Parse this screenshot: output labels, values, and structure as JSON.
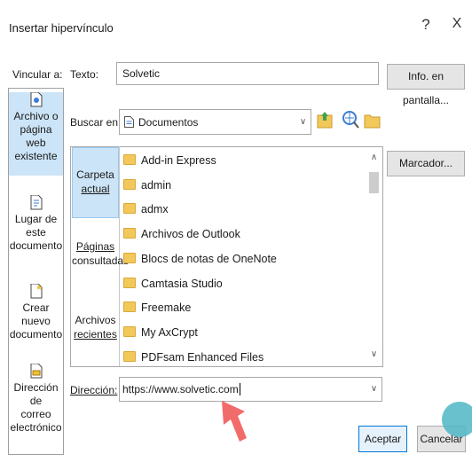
{
  "dialog": {
    "title": "Insertar hipervínculo",
    "help_label": "?",
    "close_label": "X"
  },
  "link_to": {
    "label": "Vincular a:",
    "items": [
      {
        "label": "Archivo o página web existente",
        "lines": [
          "Archivo o",
          "página web",
          "existente"
        ],
        "selected": true,
        "icon": "web-file-icon"
      },
      {
        "label": "Lugar de este documento",
        "lines": [
          "Lugar de este",
          "documento"
        ],
        "selected": false,
        "icon": "document-place-icon"
      },
      {
        "label": "Crear nuevo documento",
        "lines": [
          "Crear nuevo",
          "documento"
        ],
        "selected": false,
        "icon": "new-document-icon"
      },
      {
        "label": "Dirección de correo electrónico",
        "lines": [
          "Dirección de",
          "correo",
          "electrónico"
        ],
        "selected": false,
        "icon": "email-address-icon"
      }
    ]
  },
  "text_row": {
    "label": "Texto:",
    "value": "Solvetic",
    "screentip_button": "Info. en pantalla..."
  },
  "look_in": {
    "label": "Buscar en:",
    "value": "Documentos",
    "icons": [
      "up-folder-icon",
      "browse-web-icon",
      "browse-file-icon"
    ]
  },
  "places": [
    {
      "label": "Carpeta actual",
      "lines": [
        "Carpeta",
        "actual"
      ],
      "selected": true
    },
    {
      "label": "Páginas consultadas",
      "lines": [
        "Páginas",
        "consultadas"
      ],
      "selected": false
    },
    {
      "label": "Archivos recientes",
      "lines": [
        "Archivos",
        "recientes"
      ],
      "selected": false
    }
  ],
  "files": [
    "Add-in Express",
    "admin",
    "admx",
    "Archivos de Outlook",
    "Blocs de notas de OneNote",
    "Camtasia Studio",
    "Freemake",
    "My AxCrypt",
    "PDFsam Enhanced Files"
  ],
  "bookmark_button": "Marcador...",
  "address": {
    "label": "Dirección:",
    "value": "https://www.solvetic.com"
  },
  "buttons": {
    "ok": "Aceptar",
    "cancel": "Cancelar"
  },
  "colors": {
    "selection": "#cce4f7",
    "folder": "#f3c85a",
    "arrow": "#f26b6b"
  }
}
